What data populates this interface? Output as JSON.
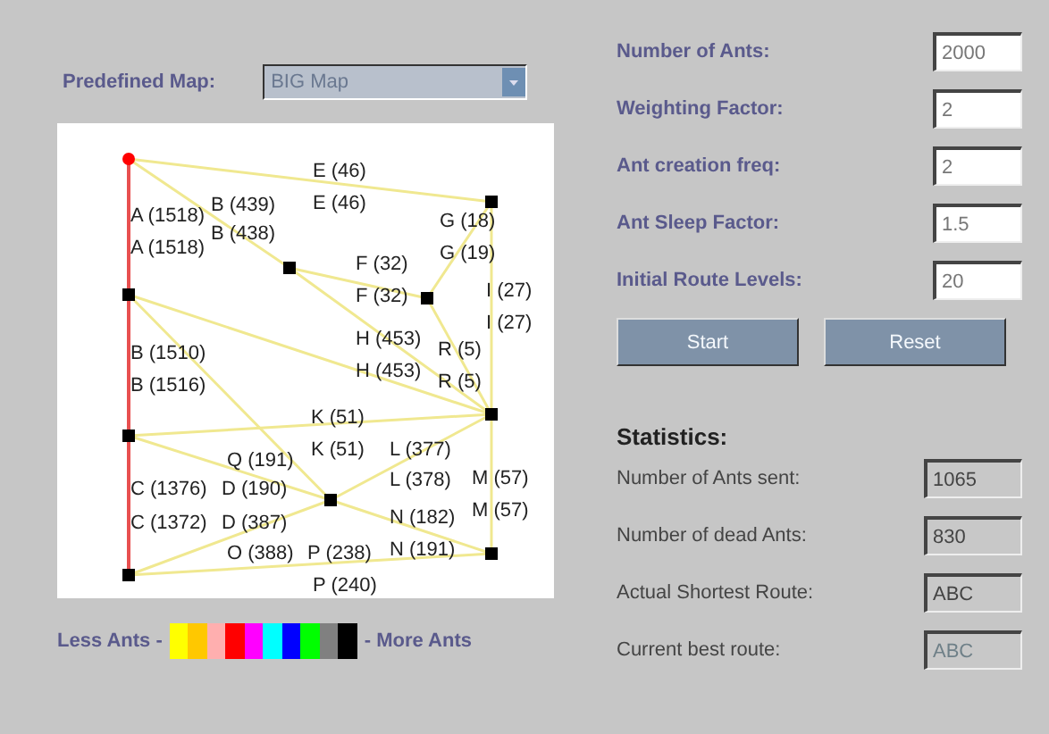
{
  "map_selector": {
    "label": "Predefined Map:",
    "value": "BIG Map"
  },
  "map": {
    "edge_labels": [
      "E (46)",
      "E (46)",
      "A (1518)",
      "A (1518)",
      "B (439)",
      "B (438)",
      "G (18)",
      "G (19)",
      "F (32)",
      "F (32)",
      "I (27)",
      "I (27)",
      "H (453)",
      "H (453)",
      "R (5)",
      "R (5)",
      "B (1510)",
      "B (1516)",
      "K (51)",
      "K (51)",
      "Q (191)",
      "L (377)",
      "L (378)",
      "M (57)",
      "M (57)",
      "C (1376)",
      "D (190)",
      "C (1372)",
      "D (387)",
      "N (182)",
      "O (388)",
      "P (238)",
      "N (191)",
      "P (240)"
    ]
  },
  "legend": {
    "low_label": "Less Ants -",
    "high_label": "- More Ants",
    "swatches": [
      {
        "color": "#ffff00"
      },
      {
        "color": "#ffc800"
      },
      {
        "color": "#ffafaf"
      },
      {
        "color": "#ff0000"
      },
      {
        "color": "#ff00ff"
      },
      {
        "color": "#00ffff"
      },
      {
        "color": "#0000ff"
      },
      {
        "color": "#00ff00"
      },
      {
        "color": "#808080"
      },
      {
        "color": "#000000"
      }
    ]
  },
  "parameters": [
    {
      "label": "Number of Ants:",
      "value": "2000"
    },
    {
      "label": "Weighting Factor:",
      "value": "2"
    },
    {
      "label": "Ant creation freq:",
      "value": "2"
    },
    {
      "label": "Ant Sleep Factor:",
      "value": "1.5"
    },
    {
      "label": "Initial Route Levels:",
      "value": "20"
    }
  ],
  "buttons": [
    {
      "label": "Start",
      "disabled": true
    },
    {
      "label": "Reset",
      "disabled": true
    }
  ],
  "statistics": {
    "title": "Statistics:",
    "rows": [
      {
        "label": "Number of Ants sent:",
        "value": "1065",
        "disabled": false
      },
      {
        "label": "Number of dead Ants:",
        "value": "830",
        "disabled": false
      },
      {
        "label": "Actual Shortest Route:",
        "value": "ABC",
        "disabled": false
      },
      {
        "label": "Current best route:",
        "value": "ABC",
        "disabled": true
      }
    ]
  }
}
